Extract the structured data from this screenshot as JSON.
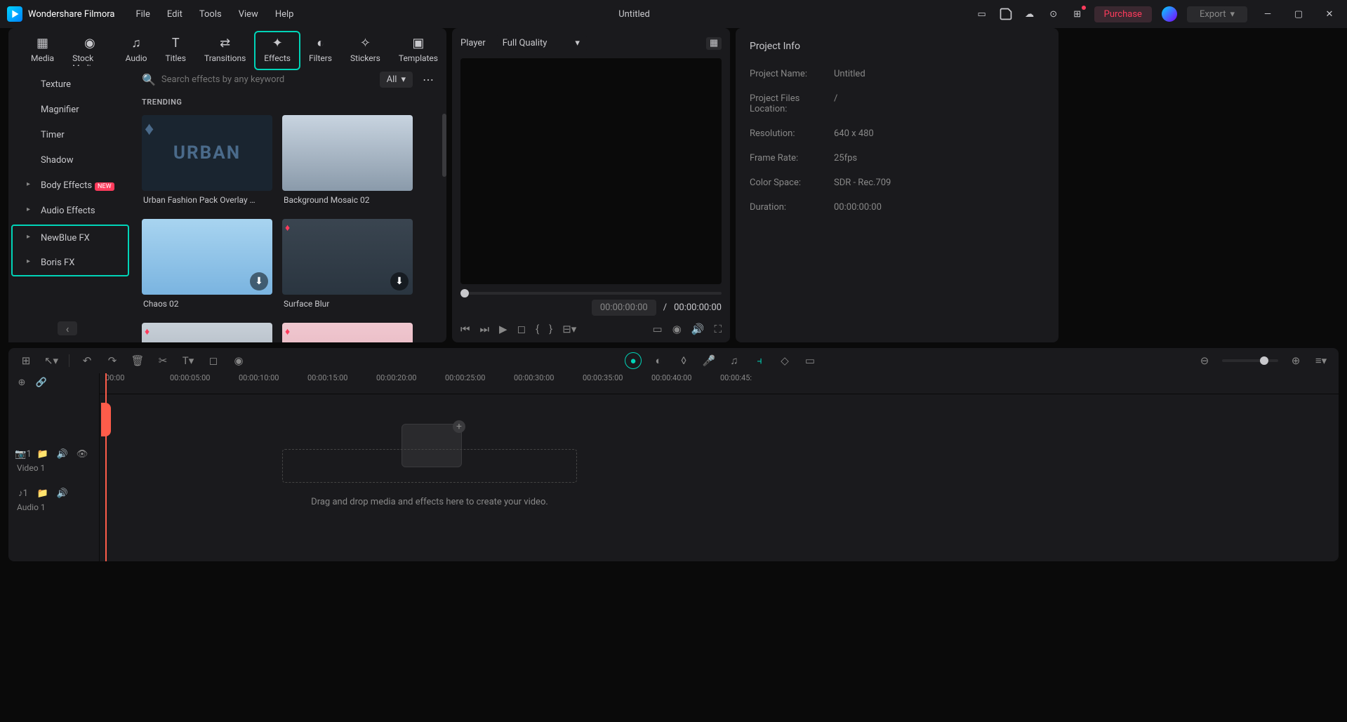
{
  "app": {
    "name": "Wondershare Filmora",
    "title": "Untitled"
  },
  "menubar": [
    "File",
    "Edit",
    "Tools",
    "View",
    "Help"
  ],
  "title_right": {
    "purchase": "Purchase",
    "export": "Export"
  },
  "tabs": [
    {
      "label": "Media"
    },
    {
      "label": "Stock Media"
    },
    {
      "label": "Audio"
    },
    {
      "label": "Titles"
    },
    {
      "label": "Transitions"
    },
    {
      "label": "Effects"
    },
    {
      "label": "Filters"
    },
    {
      "label": "Stickers"
    },
    {
      "label": "Templates"
    }
  ],
  "active_tab": 5,
  "search": {
    "placeholder": "Search effects by any keyword",
    "filter": "All"
  },
  "section_heading": "TRENDING",
  "categories": {
    "plain": [
      "Texture",
      "Magnifier",
      "Timer",
      "Shadow"
    ],
    "body_effects": "Body Effects",
    "body_badge": "NEW",
    "audio_effects": "Audio Effects",
    "highlighted": [
      "NewBlue FX",
      "Boris FX"
    ]
  },
  "effects": [
    {
      "label": "Urban Fashion Pack Overlay …"
    },
    {
      "label": "Background Mosaic 02"
    },
    {
      "label": "Chaos 02"
    },
    {
      "label": "Surface Blur"
    }
  ],
  "player": {
    "label": "Player",
    "quality": "Full Quality",
    "time_current": "00:00:00:00",
    "sep": "/",
    "time_total": "00:00:00:00"
  },
  "project": {
    "heading": "Project Info",
    "rows": [
      {
        "label": "Project Name:",
        "value": "Untitled"
      },
      {
        "label": "Project Files Location:",
        "value": "/"
      },
      {
        "label": "Resolution:",
        "value": "640 x 480"
      },
      {
        "label": "Frame Rate:",
        "value": "25fps"
      },
      {
        "label": "Color Space:",
        "value": "SDR - Rec.709"
      },
      {
        "label": "Duration:",
        "value": "00:00:00:00"
      }
    ]
  },
  "ruler": [
    "00:00",
    "00:00:05:00",
    "00:00:10:00",
    "00:00:15:00",
    "00:00:20:00",
    "00:00:25:00",
    "00:00:30:00",
    "00:00:35:00",
    "00:00:40:00",
    "00:00:45:"
  ],
  "tracks": {
    "video": "Video 1",
    "audio": "Audio 1",
    "video_n": "1",
    "audio_n": "1"
  },
  "drop_text": "Drag and drop media and effects here to create your video."
}
